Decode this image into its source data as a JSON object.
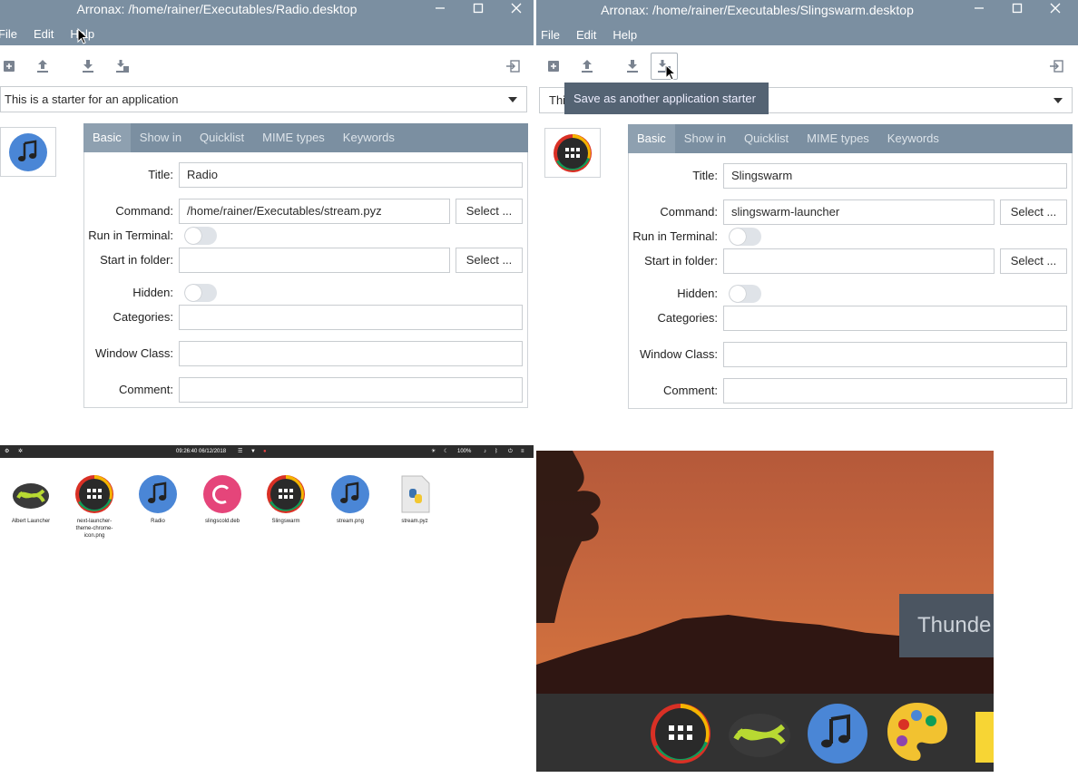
{
  "left_window": {
    "title": "Arronax: /home/rainer/Executables/Radio.desktop",
    "menu": [
      "File",
      "Edit",
      "Help"
    ],
    "combo": "This is a starter for an application",
    "tabs": [
      "Basic",
      "Show in",
      "Quicklist",
      "MIME types",
      "Keywords"
    ],
    "labels": {
      "title": "Title:",
      "command": "Command:",
      "run_in_terminal": "Run in Terminal:",
      "start_in_folder": "Start in folder:",
      "hidden": "Hidden:",
      "categories": "Categories:",
      "window_class": "Window Class:",
      "comment": "Comment:"
    },
    "values": {
      "title": "Radio",
      "command": "/home/rainer/Executables/stream.pyz",
      "start_in_folder": "",
      "categories": "",
      "window_class": "",
      "comment": ""
    },
    "select_label": "Select ..."
  },
  "right_window": {
    "title": "Arronax: /home/rainer/Executables/Slingswarm.desktop",
    "menu": [
      "File",
      "Edit",
      "Help"
    ],
    "combo": "Thi",
    "tooltip": "Save as another application starter",
    "tabs": [
      "Basic",
      "Show in",
      "Quicklist",
      "MIME types",
      "Keywords"
    ],
    "labels": {
      "title": "Title:",
      "command": "Command:",
      "run_in_terminal": "Run in Terminal:",
      "start_in_folder": "Start in folder:",
      "hidden": "Hidden:",
      "categories": "Categories:",
      "window_class": "Window Class:",
      "comment": "Comment:"
    },
    "values": {
      "title": "Slingswarm",
      "command": "slingswarm-launcher",
      "start_in_folder": "",
      "categories": "",
      "window_class": "",
      "comment": ""
    },
    "select_label": "Select ..."
  },
  "desktop": {
    "clock": "09:26:40  06/12/2018",
    "battery": "100%",
    "icons": [
      {
        "label": "Albert Launcher"
      },
      {
        "label": "next-launcher-theme-chrome-icon.png"
      },
      {
        "label": "Radio"
      },
      {
        "label": "slingscold.deb"
      },
      {
        "label": "Slingswarm"
      },
      {
        "label": "stream.png"
      },
      {
        "label": "stream.pyz"
      }
    ]
  },
  "zoom": {
    "popup_text": "Thunde"
  },
  "colors": {
    "titlebar": "#7b8fa1",
    "tab_active": "#8ea0b0",
    "tooltip": "#546373",
    "music_blue": "#4a86d6",
    "debian_pink": "#e5457a"
  }
}
